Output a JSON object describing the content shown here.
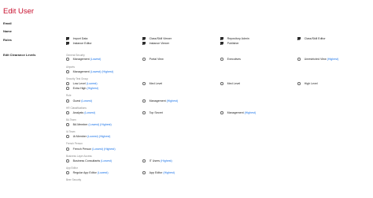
{
  "page": {
    "title": "Edit User"
  },
  "fields": {
    "email_label": "Email",
    "name_label": "Name",
    "roles_label": "Roles"
  },
  "roles": [
    {
      "label": "Import Data",
      "checked": true
    },
    {
      "label": "Class/Skill Viewer",
      "checked": true
    },
    {
      "label": "Repository Admin",
      "checked": true
    },
    {
      "label": "Class/Skill Editor",
      "checked": true
    },
    {
      "label": "Instance Editor",
      "checked": true
    },
    {
      "label": "Instance Viewer",
      "checked": true
    },
    {
      "label": "Publisher",
      "checked": true
    }
  ],
  "clearance": {
    "label": "Edit Clearance Levels",
    "groups": [
      {
        "title": "General Security",
        "options": [
          {
            "label": "Management",
            "qualifier": "(Lowest)"
          },
          {
            "label": "Portal View",
            "qualifier": ""
          },
          {
            "label": "Executives",
            "qualifier": ""
          },
          {
            "label": "Unrestricted View",
            "qualifier": "(Highest)"
          }
        ]
      },
      {
        "title": "Airports",
        "options": [
          {
            "label": "Management",
            "qualifier": "(Lowest) (Highest)"
          }
        ]
      },
      {
        "title": "Security Test Group",
        "options": [
          {
            "label": "Low Level",
            "qualifier": "(Lowest)"
          },
          {
            "label": "Med Level",
            "qualifier": ""
          },
          {
            "label": "Med Level",
            "qualifier": ""
          },
          {
            "label": "High Level",
            "qualifier": ""
          },
          {
            "label": "Extra High",
            "qualifier": "(Highest)"
          }
        ]
      },
      {
        "title": "Role",
        "options": [
          {
            "label": "Guest",
            "qualifier": "(Lowest)"
          },
          {
            "label": "Management",
            "qualifier": "(Highest)"
          }
        ]
      },
      {
        "title": "HR Classifications",
        "options": [
          {
            "label": "Analysts",
            "qualifier": "(Lowest)"
          },
          {
            "label": "Top Secret",
            "qualifier": ""
          },
          {
            "label": "Management",
            "qualifier": "(Highest)"
          }
        ]
      },
      {
        "title": "BA Team",
        "options": [
          {
            "label": "BA Member",
            "qualifier": "(Lowest) (Highest)"
          }
        ]
      },
      {
        "title": "IA Team",
        "options": [
          {
            "label": "IA Member",
            "qualifier": "(Lowest) (Highest)"
          }
        ]
      },
      {
        "title": "French Person",
        "options": [
          {
            "label": "French Person",
            "qualifier": "(Lowest) (Highest)"
          }
        ]
      },
      {
        "title": "Business Layer Access",
        "options": [
          {
            "label": "Business Consultants",
            "qualifier": "(Lowest)"
          },
          {
            "label": "IT Users",
            "qualifier": "(Highest)"
          }
        ]
      },
      {
        "title": "App Editor",
        "options": [
          {
            "label": "Regular App Editor",
            "qualifier": "(Lowest)"
          },
          {
            "label": "App Editor",
            "qualifier": "(Highest)"
          }
        ]
      },
      {
        "title": "Beer Security",
        "options": []
      }
    ]
  }
}
